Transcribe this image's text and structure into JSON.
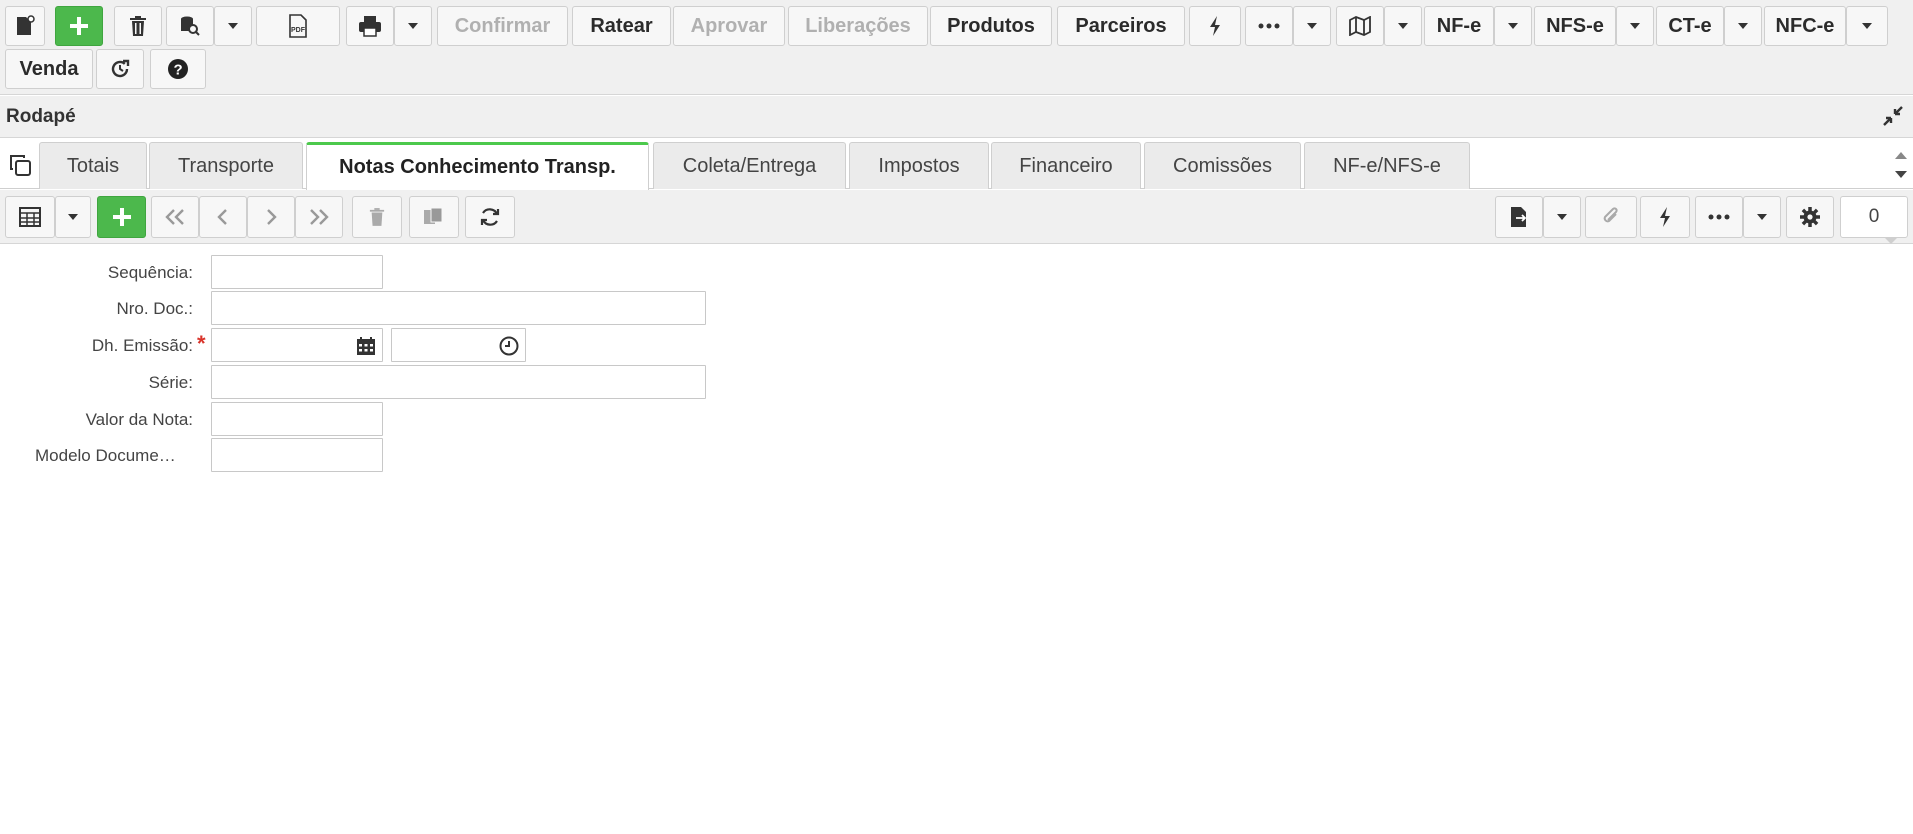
{
  "toolbar": {
    "confirmar": "Confirmar",
    "ratear": "Ratear",
    "aprovar": "Aprovar",
    "liberacoes": "Liberações",
    "produtos": "Produtos",
    "parceiros": "Parceiros",
    "nfe": "NF-e",
    "nfse": "NFS-e",
    "cte": "CT-e",
    "nfce": "NFC-e",
    "venda": "Venda"
  },
  "rodape": {
    "title": "Rodapé"
  },
  "tabs": [
    {
      "label": "Totais"
    },
    {
      "label": "Transporte"
    },
    {
      "label": "Notas Conhecimento Transp."
    },
    {
      "label": "Coleta/Entrega"
    },
    {
      "label": "Impostos"
    },
    {
      "label": "Financeiro"
    },
    {
      "label": "Comissões"
    },
    {
      "label": "NF-e/NFS-e"
    }
  ],
  "active_tab": "Notas Conhecimento Transp.",
  "grid_toolbar": {
    "record_count": "0"
  },
  "form": {
    "sequencia_label": "Sequência:",
    "nro_doc_label": "Nro. Doc.:",
    "dh_emissao_label": "Dh. Emissão:",
    "required_mark": "*",
    "serie_label": "Série:",
    "valor_nota_label": "Valor da Nota:",
    "modelo_doc_label": "Modelo Docume…",
    "sequencia_value": "",
    "nro_doc_value": "",
    "dh_emissao_date_value": "",
    "dh_emissao_time_value": "",
    "serie_value": "",
    "valor_nota_value": "",
    "modelo_doc_value": ""
  },
  "colors": {
    "accent_green": "#4cb84c",
    "active_tab_border": "#4cc94c",
    "required_red": "#d9342b"
  }
}
